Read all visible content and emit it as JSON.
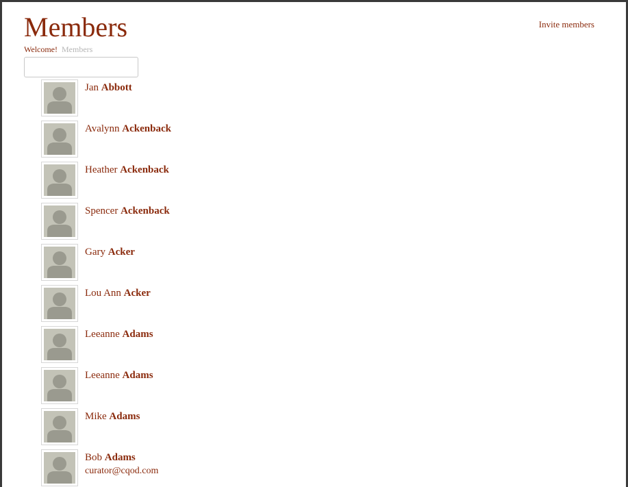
{
  "page": {
    "title": "Members",
    "invite_label": "Invite members"
  },
  "breadcrumb": {
    "home": "Welcome!",
    "current": "Members"
  },
  "search": {
    "value": "",
    "placeholder": ""
  },
  "colors": {
    "accent": "#8a2a0c",
    "top_bar": "#c0431a",
    "avatar_bg": "#c3c3b7",
    "avatar_figure": "#9a9a8f"
  },
  "members": [
    {
      "first": "Jan",
      "last": "Abbott",
      "email": "",
      "avatar_icon": "default-user-icon"
    },
    {
      "first": "Avalynn",
      "last": "Ackenback",
      "email": "",
      "avatar_icon": "default-user-icon"
    },
    {
      "first": "Heather",
      "last": "Ackenback",
      "email": "",
      "avatar_icon": "default-user-icon"
    },
    {
      "first": "Spencer",
      "last": "Ackenback",
      "email": "",
      "avatar_icon": "default-user-icon"
    },
    {
      "first": "Gary",
      "last": "Acker",
      "email": "",
      "avatar_icon": "default-user-icon"
    },
    {
      "first": "Lou Ann",
      "last": "Acker",
      "email": "",
      "avatar_icon": "default-user-icon"
    },
    {
      "first": "Leeanne",
      "last": "Adams",
      "email": "",
      "avatar_icon": "default-user-icon"
    },
    {
      "first": "Leeanne",
      "last": "Adams",
      "email": "",
      "avatar_icon": "default-user-icon"
    },
    {
      "first": "Mike",
      "last": "Adams",
      "email": "",
      "avatar_icon": "default-user-icon"
    },
    {
      "first": "Bob",
      "last": "Adams",
      "email": "curator@cqod.com",
      "avatar_icon": "default-user-icon"
    }
  ]
}
